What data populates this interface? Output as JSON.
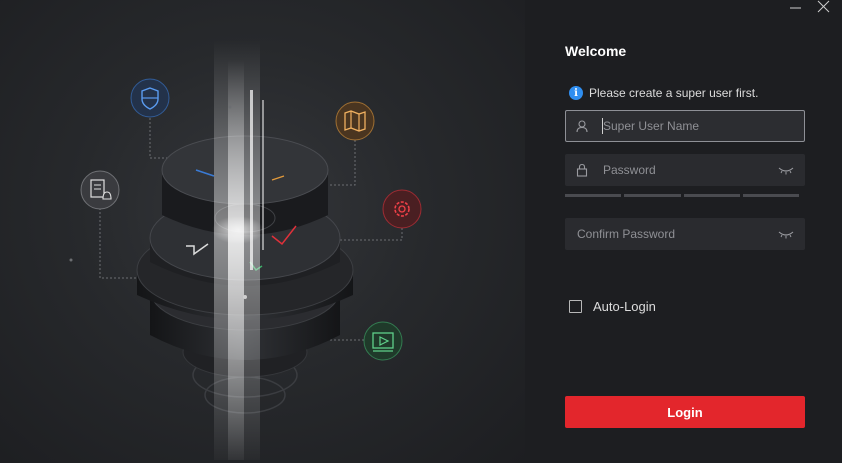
{
  "window": {
    "minimize_icon": "minimize-icon",
    "close_icon": "close-icon"
  },
  "panel": {
    "title": "Welcome",
    "hint": "Please create a super user first.",
    "username": {
      "placeholder": "Super User Name",
      "value": ""
    },
    "password": {
      "placeholder": "Password",
      "value": ""
    },
    "confirm": {
      "placeholder": "Confirm Password",
      "value": ""
    },
    "autologin_label": "Auto-Login",
    "autologin_checked": false,
    "login_label": "Login",
    "strength_segments": 4
  },
  "illustration": {
    "icons": [
      "shield-icon",
      "map-icon",
      "notification-doc-icon",
      "settings-icon",
      "video-icon"
    ],
    "colors": {
      "shield": "#3a7bd5",
      "map": "#e39a3b",
      "doc": "#d0d0d0",
      "settings": "#e0303a",
      "video": "#3fae6a"
    }
  },
  "colors": {
    "accent": "#e3262c",
    "info": "#2f8ef0",
    "panel_bg": "#1d1e21",
    "field_bg": "#2a2b2f"
  }
}
